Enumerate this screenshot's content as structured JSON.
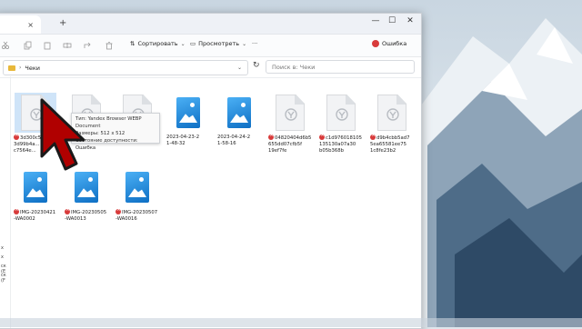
{
  "window": {
    "tab_close": "×",
    "tab_add": "+",
    "minimize": "—",
    "maximize": "☐",
    "close": "✕"
  },
  "toolbar": {
    "sort_label": "Сортировать",
    "view_label": "Просмотреть",
    "more_label": "···",
    "error_label": "Ошибка"
  },
  "address": {
    "path": "Чеки",
    "search_placeholder": "Поиск в: Чеки"
  },
  "nav": {
    "items": [
      "х",
      "х",
      "ск (E",
      "ск (F"
    ]
  },
  "files": [
    {
      "name": "3d300c5f...\n3d99b4a...\nc7564e...",
      "type": "doc",
      "error": true,
      "selected": true
    },
    {
      "name": "",
      "type": "doc",
      "error": false
    },
    {
      "name": "",
      "type": "doc",
      "error": false
    },
    {
      "name": "2023-04-23-2\n1-48-32",
      "type": "image",
      "error": false
    },
    {
      "name": "2023-04-24-2\n1-58-16",
      "type": "image",
      "error": false
    },
    {
      "name": "04820404d6b5\n655dd07cfb5f\n19ef7fe",
      "type": "doc",
      "error": true
    },
    {
      "name": "c1d976018105\n135130a07a30\nb05b368b",
      "type": "doc",
      "error": true
    },
    {
      "name": "d9b4cbb5ad7\n5ea65581ee75\n1c8fe23b2",
      "type": "doc",
      "error": true
    },
    {
      "name": "IMG-20230421\n-WA0002",
      "type": "image",
      "error": true
    },
    {
      "name": "IMG-20230505\n-WA0013",
      "type": "image",
      "error": true
    },
    {
      "name": "IMG-20230507\n-WA0016",
      "type": "image",
      "error": true
    }
  ],
  "tooltip": {
    "line1": "Тип: Yandex Browser WEBP Document",
    "line2": "Размеры: 512 x 512",
    "line3": "Состояние доступности: Ошибка"
  },
  "colors": {
    "accent": "#1f8be0",
    "error": "#d83b3b",
    "folder": "#e8b83a"
  }
}
